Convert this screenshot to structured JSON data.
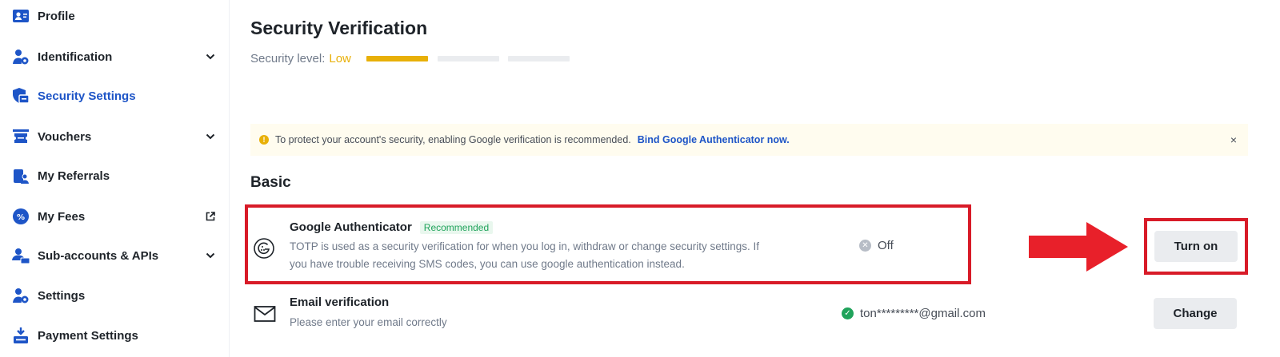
{
  "sidebar": {
    "items": [
      {
        "label": "Profile",
        "icon": "profile-icon",
        "tail": ""
      },
      {
        "label": "Identification",
        "icon": "identification-icon",
        "tail": "chevron-down-icon"
      },
      {
        "label": "Security Settings",
        "icon": "shield-icon",
        "tail": "",
        "active": true
      },
      {
        "label": "Vouchers",
        "icon": "voucher-icon",
        "tail": "chevron-down-icon"
      },
      {
        "label": "My Referrals",
        "icon": "referral-icon",
        "tail": ""
      },
      {
        "label": "My Fees",
        "icon": "percent-icon",
        "tail": "external-link-icon"
      },
      {
        "label": "Sub-accounts & APIs",
        "icon": "sub-accounts-icon",
        "tail": "chevron-down-icon"
      },
      {
        "label": "Settings",
        "icon": "user-gear-icon",
        "tail": ""
      },
      {
        "label": "Payment Settings",
        "icon": "payment-icon",
        "tail": ""
      }
    ]
  },
  "main": {
    "title": "Security Verification",
    "security_level_label": "Security level:",
    "security_level_value": "Low",
    "security_level_segments_filled": 1,
    "security_level_segments_total": 3,
    "notice": {
      "text": "To protect your account's security, enabling Google verification is recommended.",
      "link": "Bind Google Authenticator now.",
      "close": "×"
    },
    "section_title": "Basic",
    "rows": [
      {
        "title": "Google Authenticator",
        "badge": "Recommended",
        "desc_line1": "TOTP is used as a security verification for when you log in, withdraw or change security settings. If",
        "desc_line2": "you have trouble receiving SMS codes, you can use google authentication instead.",
        "status": "Off",
        "button": "Turn on"
      },
      {
        "title": "Email verification",
        "desc_line1": "Please enter your email correctly",
        "status": "ton*********@gmail.com",
        "button": "Change"
      }
    ]
  },
  "colors": {
    "accent": "#1e55c7",
    "level_low": "#e8b008",
    "annotation_red": "#d81b28",
    "success": "#20a35b"
  }
}
